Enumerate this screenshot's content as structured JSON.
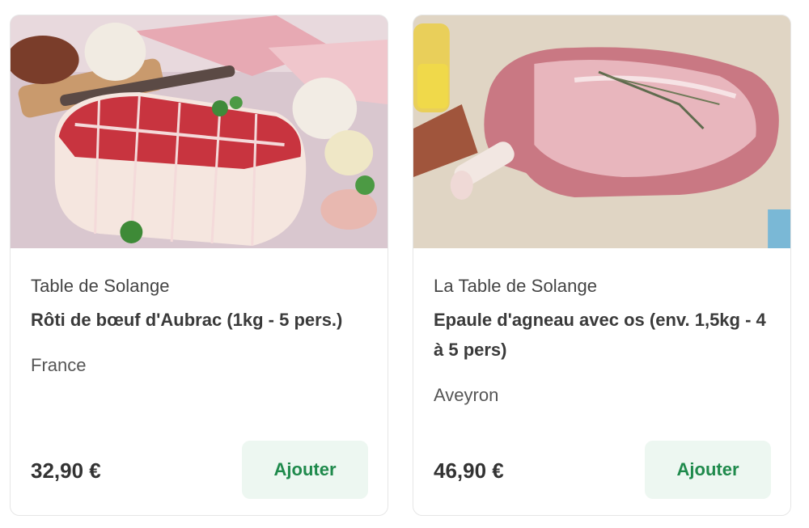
{
  "products": [
    {
      "image_alt": "Rôti de boeuf ficelé",
      "seller": "Table de Solange",
      "title": "Rôti de bœuf d'Aubrac (1kg - 5 pers.)",
      "origin": "France",
      "price": "32,90 €",
      "add_label": "Ajouter"
    },
    {
      "image_alt": "Epaule d'agneau",
      "seller": "La Table de Solange",
      "title": "Epaule d'agneau avec os (env. 1,5kg - 4 à 5 pers)",
      "origin": "Aveyron",
      "price": "46,90 €",
      "add_label": "Ajouter"
    }
  ],
  "colors": {
    "button_bg": "#edf7f1",
    "button_text": "#1f8a4c",
    "text": "#333333"
  }
}
